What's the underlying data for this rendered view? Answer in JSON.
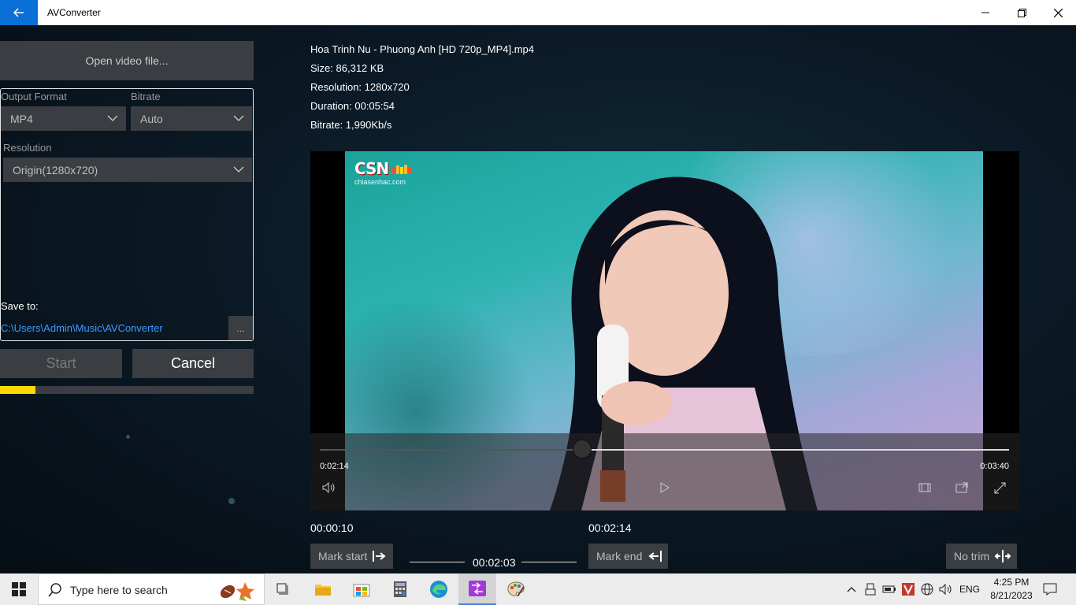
{
  "titlebar": {
    "title": "AVConverter"
  },
  "left_panel": {
    "open_button": "Open video file...",
    "output_format_label": "Output Format",
    "output_format_value": "MP4",
    "bitrate_label": "Bitrate",
    "bitrate_value": "Auto",
    "resolution_label": "Resolution",
    "resolution_value": "Origin(1280x720)",
    "save_to_label": "Save to:",
    "save_path": "C:\\Users\\Admin\\Music\\AVConverter",
    "browse_label": "...",
    "start_label": "Start",
    "cancel_label": "Cancel",
    "progress_fraction": 0.14
  },
  "file_info": {
    "name": "Hoa Trinh Nu - Phuong Anh [HD 720p_MP4].mp4",
    "size": "Size: 86,312 KB",
    "resolution": "Resolution: 1280x720",
    "duration": "Duration: 00:05:54",
    "bitrate": "Bitrate: 1,990Kb/s"
  },
  "player": {
    "current_time": "0:02:14",
    "end_time": "0:03:40",
    "position_fraction": 0.38,
    "logo_text": "CSN",
    "logo_subtext": "chiasenhac.com"
  },
  "trim": {
    "start_time": "00:00:10",
    "end_time": "00:02:14",
    "duration": "00:02:03",
    "mark_start_label": "Mark start",
    "mark_end_label": "Mark end",
    "no_trim_label": "No trim"
  },
  "taskbar": {
    "search_placeholder": "Type here to search",
    "language": "ENG",
    "time": "4:25 PM",
    "date": "8/21/2023"
  },
  "colors": {
    "accent_blue": "#0a6fd6",
    "progress_yellow": "#ffd800",
    "link_blue": "#3b9cff",
    "button_gray": "#3a3e42"
  }
}
